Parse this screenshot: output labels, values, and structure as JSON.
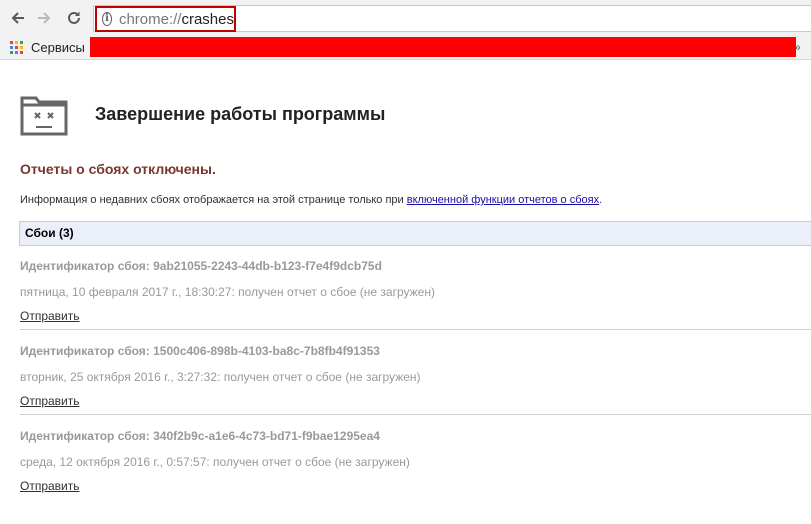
{
  "browser": {
    "url_scheme": "chrome://",
    "url_path": "crashes",
    "bookmarks_label": "Сервисы",
    "bookmarks_more": "»",
    "apps_colors": [
      "#ea4335",
      "#fbbc05",
      "#34a853",
      "#4285f4",
      "#ea4335",
      "#fbbc05",
      "#34a853",
      "#4285f4",
      "#ea4335"
    ],
    "redaction_color": "#ff0000"
  },
  "page": {
    "title": "Завершение работы программы",
    "disabled_heading": "Отчеты о сбоях отключены.",
    "info_prefix": "Информация о недавних сбоях отображается на этой странице только при ",
    "info_link": "включенной функции отчетов о сбоях",
    "info_suffix": ".",
    "section_header": "Сбои (3)"
  },
  "crashes": [
    {
      "id_line": "Идентификатор сбоя: 9ab21055-2243-44db-b123-f7e4f9dcb75d",
      "time_line": "пятница, 10 февраля 2017 г., 18:30:27: получен отчет о сбое (не загружен)",
      "send_label": "Отправить"
    },
    {
      "id_line": "Идентификатор сбоя: 1500c406-898b-4103-ba8c-7b8fb4f91353",
      "time_line": "вторник, 25 октября 2016 г., 3:27:32: получен отчет о сбое (не загружен)",
      "send_label": "Отправить"
    },
    {
      "id_line": "Идентификатор сбоя: 340f2b9c-a1e6-4c73-bd71-f9bae1295ea4",
      "time_line": "среда, 12 октября 2016 г., 0:57:57: получен отчет о сбое (не загружен)",
      "send_label": "Отправить"
    }
  ],
  "colors": {
    "heading_accent": "#7a3632",
    "link": "#1a0dab",
    "highlight_border": "#c30000"
  }
}
